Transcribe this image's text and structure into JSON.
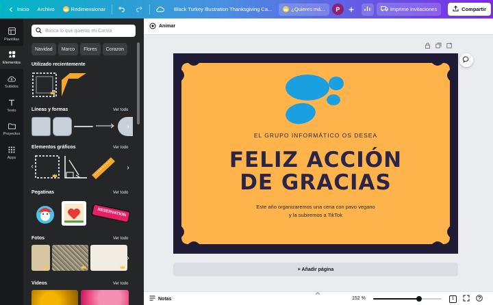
{
  "topbar": {
    "home": "Inicio",
    "file": "Archivo",
    "resize": "Redimensionar",
    "doc_title": "Black Turkey Illustration Thanksgiving Ca...",
    "upgrade": "¿Quieres má...",
    "avatar_initial": "P",
    "print": "Imprime invitaciones",
    "share": "Compartir"
  },
  "rail": [
    {
      "label": "Plantillas"
    },
    {
      "label": "Elementos"
    },
    {
      "label": "Subidos"
    },
    {
      "label": "Texto"
    },
    {
      "label": "Proyectos"
    },
    {
      "label": "Apps"
    }
  ],
  "panel": {
    "search_placeholder": "Busca lo que quieras en Canva",
    "chips": [
      "Navidad",
      "Marco",
      "Flores",
      "Corazon"
    ],
    "recent_title": "Utilizado recientemente",
    "see_all": "Ver todo",
    "lines_title": "Líneas y formas",
    "graphics_title": "Elementos gráficos",
    "stickers_title": "Pegatinas",
    "photos_title": "Fotos",
    "videos_title": "Videos",
    "sticker_banner_text": "RESERVATION"
  },
  "editor": {
    "animate": "Animar",
    "add_page": "+ Añadir página",
    "notes": "Notas",
    "zoom": "152 %",
    "zoom_fraction": 0.67,
    "page_count": "1"
  },
  "card": {
    "tagline": "EL GRUPO INFORMÁTICO OS DESEA",
    "headline_1": "FELIZ ACCIÓN",
    "headline_2": "DE GRACIAS",
    "body_1": "Este año organizaremos una cena con pavo vegano",
    "body_2": "y la subiremos a TikTok"
  },
  "colors": {
    "card_bg": "#feb44b",
    "frame_bg": "#1f1a35",
    "logo_blue": "#1aa0e0",
    "headline": "#2a2547",
    "panel_bg": "#252627",
    "rail_bg": "#18191b"
  },
  "icons": {
    "undo": "undo-icon",
    "redo": "redo-icon",
    "cloud": "cloud-sync-icon",
    "analytics": "bar-chart-icon",
    "share": "upload-icon"
  }
}
